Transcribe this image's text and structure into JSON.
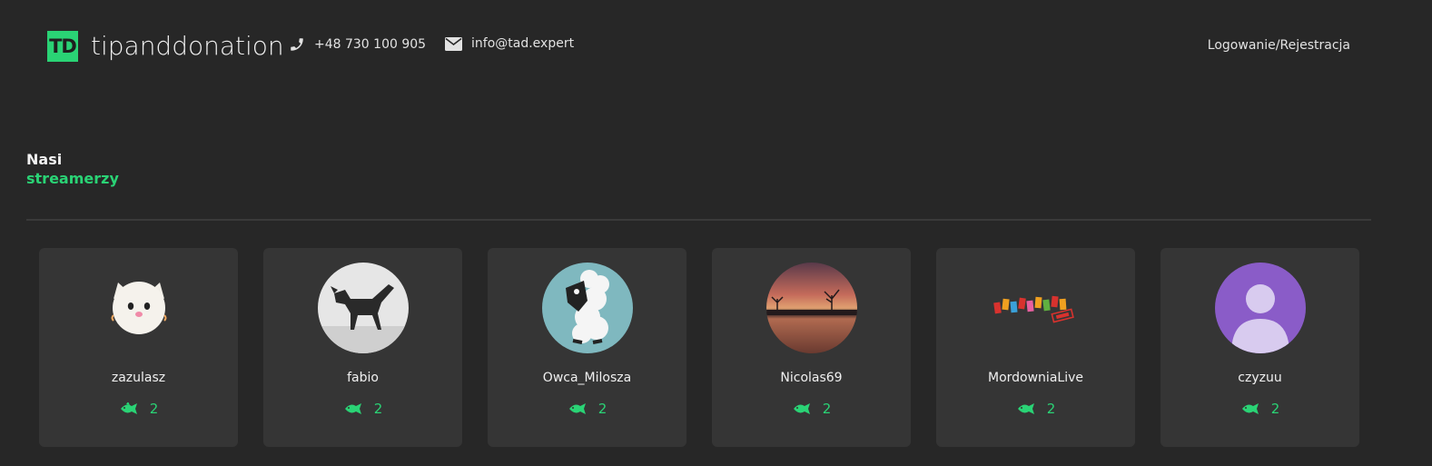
{
  "header": {
    "logo_badge": "TD",
    "logo_text": "tipanddonation",
    "phone": "+48 730 100 905",
    "email": "info@tad.expert",
    "login": "Logowanie/Rejestracja"
  },
  "section": {
    "title_line1": "Nasi",
    "title_line2": "streamerzy"
  },
  "streamers": [
    {
      "name": "zazulasz",
      "count": "2"
    },
    {
      "name": "fabio",
      "count": "2"
    },
    {
      "name": "Owca_Milosza",
      "count": "2"
    },
    {
      "name": "Nicolas69",
      "count": "2"
    },
    {
      "name": "MordowniaLive",
      "count": "2"
    },
    {
      "name": "czyzuu",
      "count": "2"
    }
  ],
  "colors": {
    "background": "#272727",
    "card": "#353535",
    "accent": "#2ad375"
  },
  "icons": {
    "phone": "phone-icon",
    "email": "envelope-icon",
    "count": "fish-icon"
  }
}
